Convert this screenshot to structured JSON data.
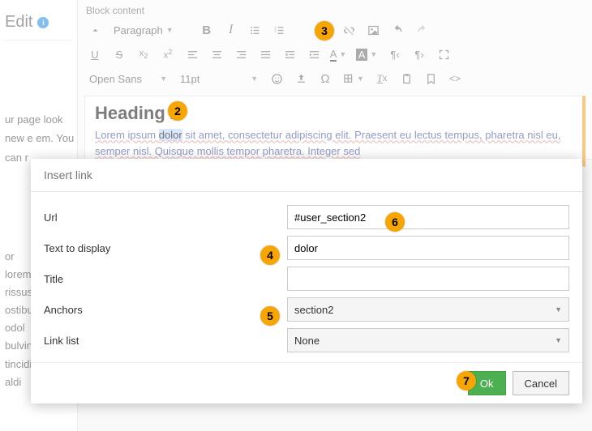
{
  "left": {
    "edit": "Edit",
    "intro": "ur page look new e em. You can r",
    "lorem": "or sit amet lorem sed od rissus. ostibulum at odol d ante. bulvinar inh t tincidi , interd lut aldi"
  },
  "editor": {
    "label": "Block content",
    "paragraph": "Paragraph",
    "font": "Open Sans",
    "size": "11pt",
    "heading": "Heading 2",
    "body": "Lorem ipsum dolor sit amet, consectetur adipiscing elit. Praesent eu lectus tempus, pharetra nisl eu, semper nisl. Quisque mollis tempor pharetra. Integer sed",
    "selected": "dolor"
  },
  "dialog": {
    "title": "Insert link",
    "url_label": "Url",
    "url_value": "#user_section2",
    "text_label": "Text to display",
    "text_value": "dolor",
    "title_label": "Title",
    "title_value": "",
    "anchors_label": "Anchors",
    "anchors_value": "section2",
    "linklist_label": "Link list",
    "linklist_value": "None",
    "ok": "Ok",
    "cancel": "Cancel"
  },
  "annotations": {
    "a2": "2",
    "a3": "3",
    "a4": "4",
    "a5": "5",
    "a6": "6",
    "a7": "7"
  }
}
